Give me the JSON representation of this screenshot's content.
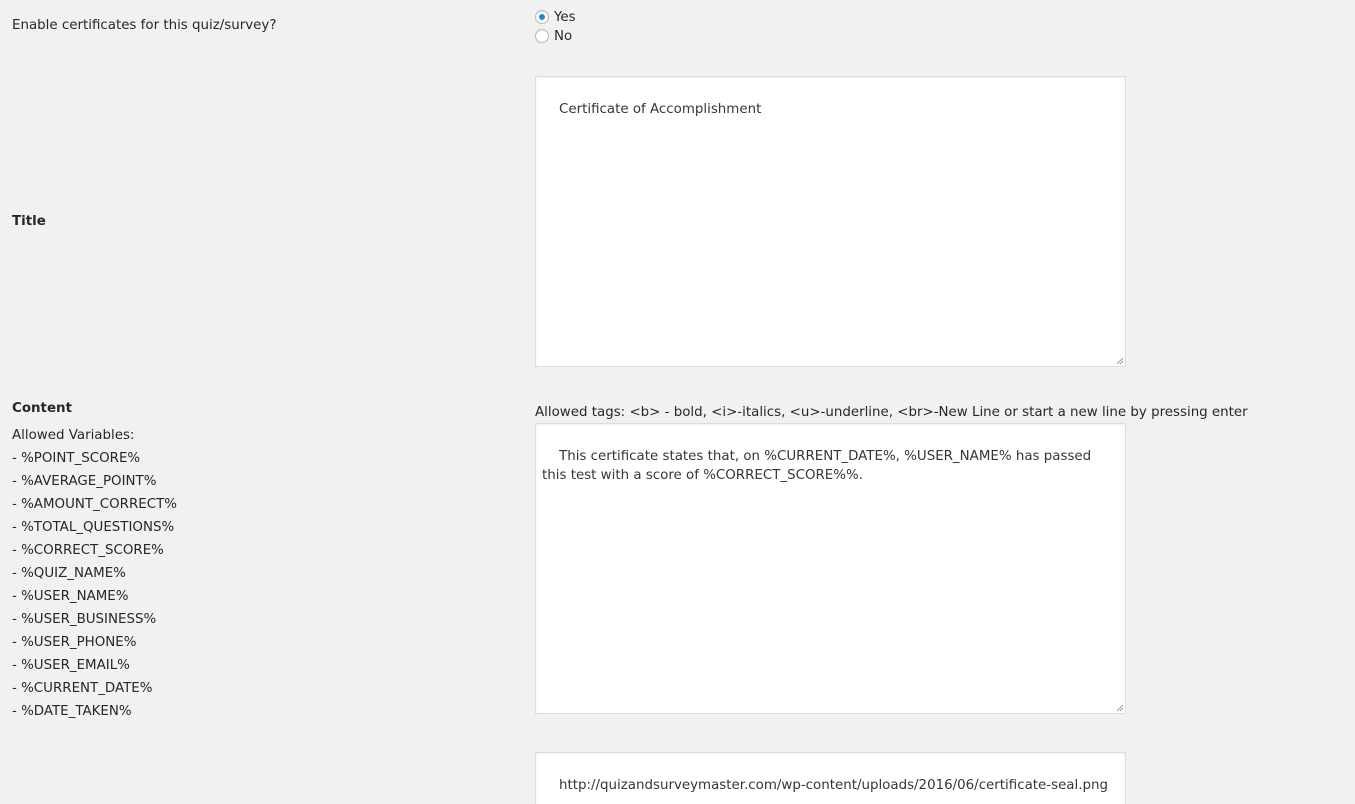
{
  "enable": {
    "question": "Enable certificates for this quiz/survey?",
    "options": [
      {
        "label": "Yes",
        "checked": true
      },
      {
        "label": "No",
        "checked": false
      }
    ]
  },
  "title_field": {
    "label": "Title",
    "value": "Certificate of Accomplishment"
  },
  "content_field": {
    "label": "Content",
    "allowed_variables_label": "Allowed Variables:",
    "variables": [
      "- %POINT_SCORE%",
      "- %AVERAGE_POINT%",
      "- %AMOUNT_CORRECT%",
      "- %TOTAL_QUESTIONS%",
      "- %CORRECT_SCORE%",
      "- %QUIZ_NAME%",
      "- %USER_NAME%",
      "- %USER_BUSINESS%",
      "- %USER_PHONE%",
      "- %USER_EMAIL%",
      "- %CURRENT_DATE%",
      "- %DATE_TAKEN%"
    ],
    "allowed_tags": "Allowed tags: <b> - bold, <i>-italics, <u>-underline, <br>-New Line or start a new line by pressing enter",
    "value": "This certificate states that, on %CURRENT_DATE%, %USER_NAME% has passed this test with a score of %CORRECT_SCORE%%."
  },
  "logo_field": {
    "value": "http://quizandsurveymaster.com/wp-content/uploads/2016/06/certificate-seal.png"
  },
  "colors": {
    "background": "#f1f1f1",
    "radio_accent": "#1e8cbe",
    "field_border": "#dddddd"
  }
}
